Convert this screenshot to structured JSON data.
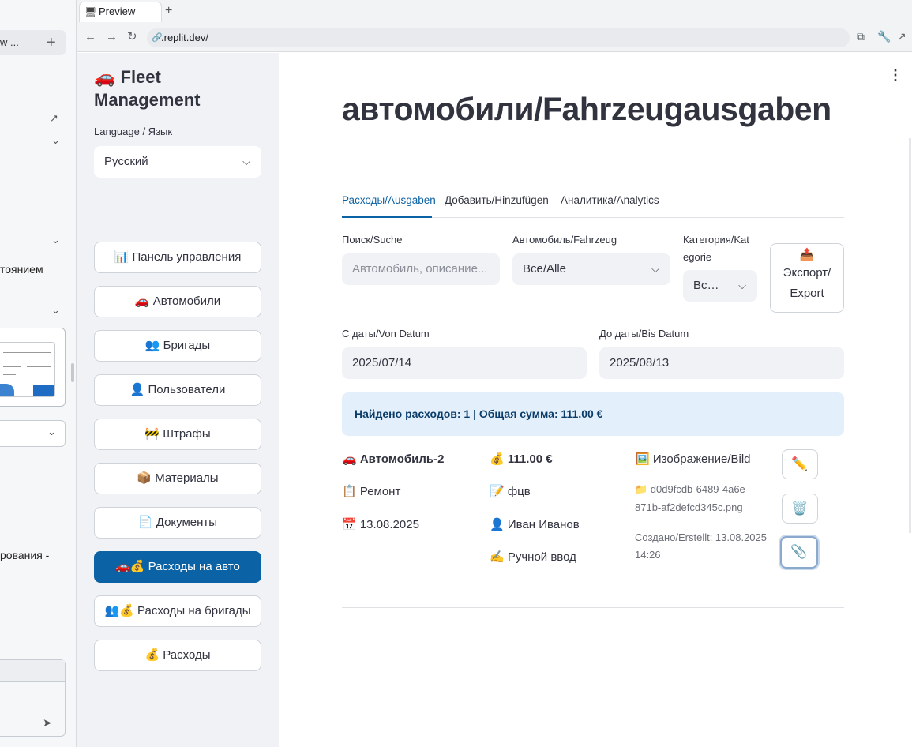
{
  "browser": {
    "tab_title": "Preview",
    "new_tab": "+",
    "url": ".replit.dev/",
    "nav": {
      "back": "←",
      "forward": "→",
      "reload": "↻"
    }
  },
  "outer": {
    "top_text": "w ...",
    "plus": "+",
    "text1": "тоянием",
    "text2": "рования -"
  },
  "sidebar": {
    "brand": "🚗 Fleet Management",
    "language_label": "Language / Язык",
    "language_value": "Русский",
    "items": [
      {
        "label": "📊 Панель управления"
      },
      {
        "label": "🚗 Автомобили"
      },
      {
        "label": "👥 Бригады"
      },
      {
        "label": "👤 Пользователи"
      },
      {
        "label": "🚧 Штрафы"
      },
      {
        "label": "📦 Материалы"
      },
      {
        "label": "📄 Документы"
      },
      {
        "label": "🚗💰 Расходы на авто"
      },
      {
        "label": "👥💰 Расходы на бригады"
      },
      {
        "label": "💰 Расходы"
      }
    ]
  },
  "main": {
    "title": "автомобили/Fahrzeugausgaben",
    "tabs": [
      {
        "label": "Расходы/Ausgaben"
      },
      {
        "label": "Добавить/Hinzufügen"
      },
      {
        "label": "Аналитика/Analytics"
      }
    ],
    "filters": {
      "search_label": "Поиск/Suche",
      "search_placeholder": "Автомобиль, описание...",
      "vehicle_label": "Автомобиль/Fahrzeug",
      "vehicle_value": "Все/Alle",
      "category_label_1": "Категория/Kat",
      "category_label_2": "egorie",
      "category_value": "Вс…",
      "export_icon": "📤",
      "export_label_1": "Экспорт/",
      "export_label_2": "Export",
      "from_label": "С даты/Von Datum",
      "from_value": "2025/07/14",
      "to_label": "До даты/Bis Datum",
      "to_value": "2025/08/13"
    },
    "summary": "Найдено расходов: 1 | Общая сумма: 111.00 €",
    "expense": {
      "vehicle": "🚗 Автомобиль-2",
      "category": "📋 Ремонт",
      "date": "📅 13.08.2025",
      "amount": "💰 111.00 €",
      "description": "📝 фцв",
      "user": "👤 Иван Иванов",
      "source": "✍️ Ручной ввод",
      "image_label": "🖼️ Изображение/Bild",
      "file_line1": "📁 d0d9fcdb-6489-4a6e-",
      "file_line2": "871b-af2defcd345c.png",
      "created_line1": "Создано/Erstellt: 13.08.2025",
      "created_line2": "14:26",
      "edit_icon": "✏️",
      "delete_icon": "🗑️",
      "attach_icon": "📎"
    },
    "menu_icon": "⋮"
  }
}
